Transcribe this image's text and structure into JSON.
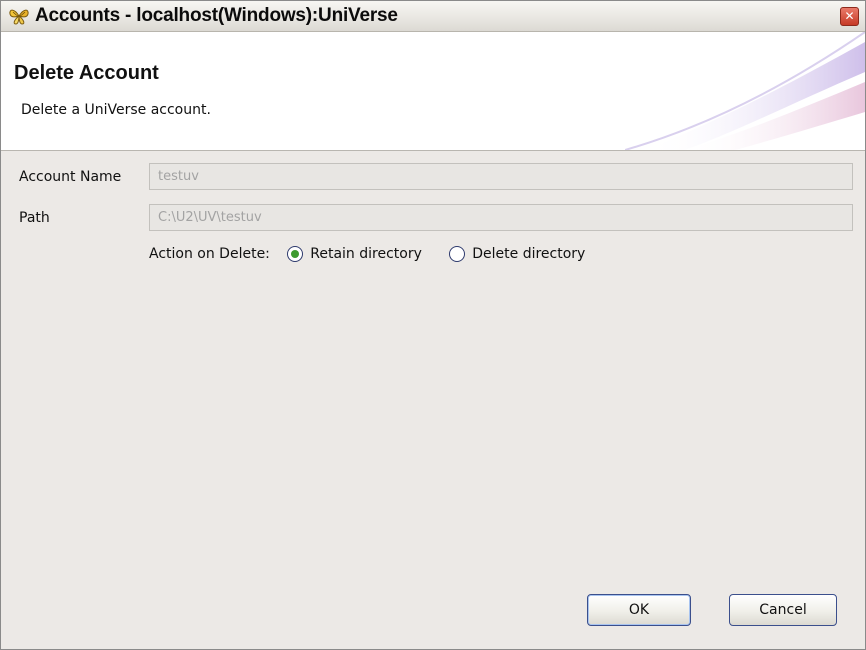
{
  "window": {
    "title": "Accounts - localhost(Windows):UniVerse",
    "app_icon": "universe-butterfly-icon",
    "close_icon": "close-icon",
    "close_glyph": "✕"
  },
  "header": {
    "title": "Delete Account",
    "description": "Delete a UniVerse account."
  },
  "form": {
    "account_name_label": "Account Name",
    "account_name_value": "testuv",
    "path_label": "Path",
    "path_value": "C:\\U2\\UV\\testuv",
    "action_label": "Action on Delete:",
    "options": [
      {
        "label": "Retain directory",
        "selected": true
      },
      {
        "label": "Delete directory",
        "selected": false
      }
    ]
  },
  "buttons": {
    "ok": "OK",
    "cancel": "Cancel"
  },
  "colors": {
    "dialog_bg": "#ece9e6",
    "radio_selected": "#3d9a2f",
    "button_border": "#3b4f8c"
  }
}
